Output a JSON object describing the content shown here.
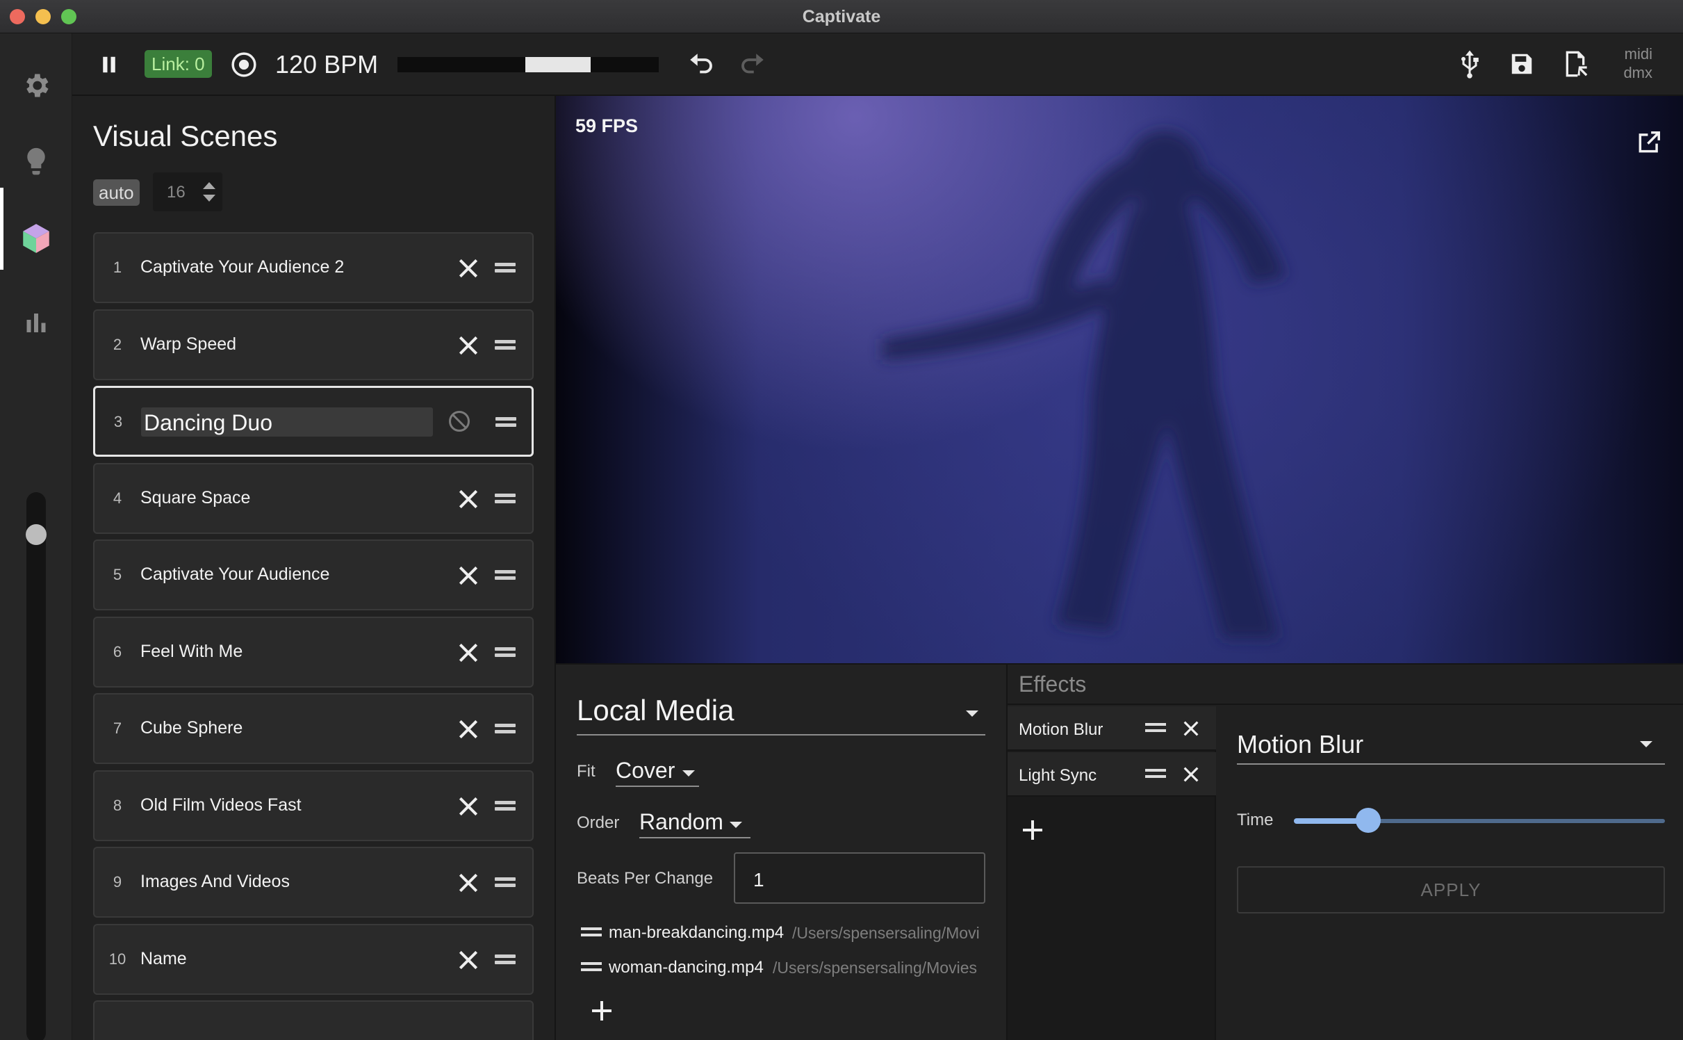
{
  "window": {
    "title": "Captivate"
  },
  "toolbar": {
    "link_label": "Link: 0",
    "bpm_label": "120 BPM",
    "beat_progress": 0.25,
    "beat_progress_start": 0.49,
    "midi_label": "midi",
    "dmx_label": "dmx",
    "status_color": "#e3342f"
  },
  "sidebar": {
    "icons": [
      "gear-icon",
      "lightbulb-icon",
      "cube-icon",
      "bar-chart-icon"
    ],
    "active": "cube-icon",
    "master_level": 0.97
  },
  "scenes": {
    "title": "Visual Scenes",
    "auto_label": "auto",
    "bombacity_value": "16",
    "items": [
      {
        "num": "1",
        "name": "Captivate Your Audience 2"
      },
      {
        "num": "2",
        "name": "Warp Speed"
      },
      {
        "num": "3",
        "name": "Dancing Duo",
        "selected": true
      },
      {
        "num": "4",
        "name": "Square Space"
      },
      {
        "num": "5",
        "name": "Captivate Your Audience"
      },
      {
        "num": "6",
        "name": "Feel With Me"
      },
      {
        "num": "7",
        "name": "Cube Sphere"
      },
      {
        "num": "8",
        "name": "Old Film Videos Fast"
      },
      {
        "num": "9",
        "name": "Images And Videos"
      },
      {
        "num": "10",
        "name": "Name"
      }
    ]
  },
  "preview": {
    "fps": "59 FPS"
  },
  "source": {
    "type": "Local Media",
    "fit_label": "Fit",
    "fit_value": "Cover",
    "order_label": "Order",
    "order_value": "Random",
    "bpc_label": "Beats Per Change",
    "bpc_value": "1",
    "files": [
      {
        "name": "man-breakdancing.mp4",
        "path": "/Users/spensersaling/Movi"
      },
      {
        "name": "woman-dancing.mp4",
        "path": "/Users/spensersaling/Movies"
      }
    ]
  },
  "effects": {
    "title": "Effects",
    "items": [
      {
        "name": "Motion Blur"
      },
      {
        "name": "Light Sync"
      }
    ],
    "selected_effect": "Motion Blur",
    "time_label": "Time",
    "time_value": 0.2,
    "apply_label": "APPLY"
  }
}
